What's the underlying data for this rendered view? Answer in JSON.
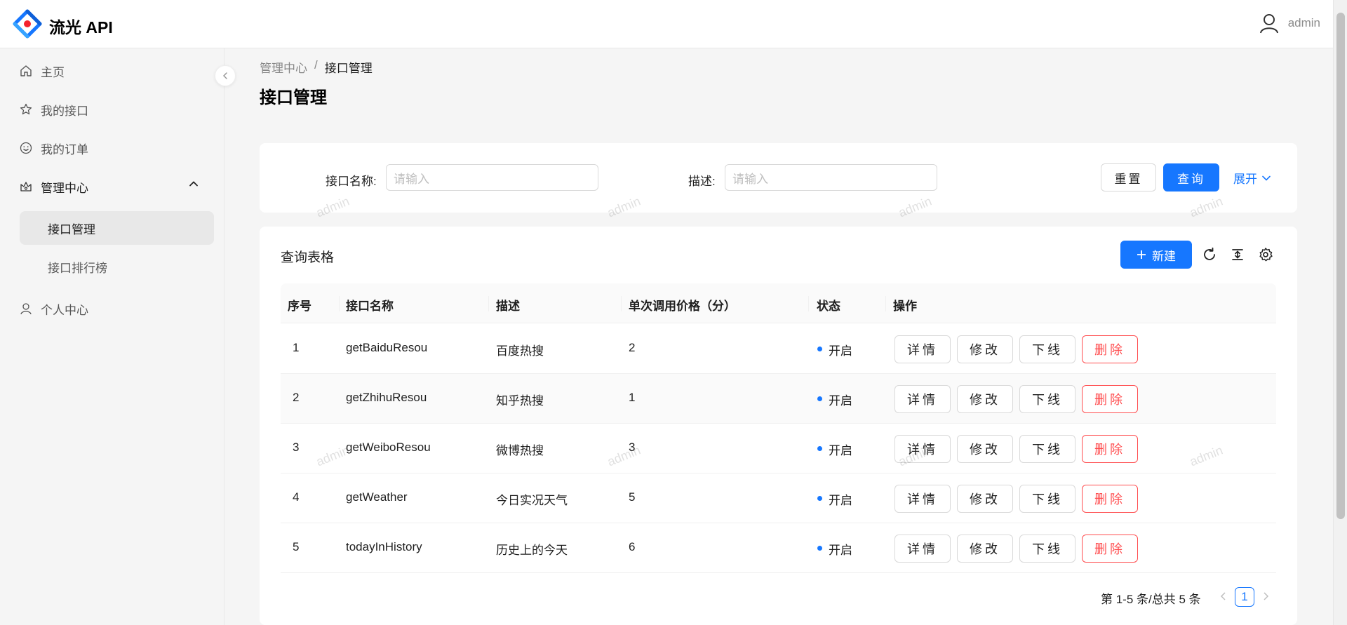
{
  "header": {
    "app_title": "流光 API",
    "username": "admin"
  },
  "sidebar": {
    "items": [
      {
        "label": "主页",
        "icon": "home-icon"
      },
      {
        "label": "我的接口",
        "icon": "star-icon"
      },
      {
        "label": "我的订单",
        "icon": "smile-icon"
      },
      {
        "label": "管理中心",
        "icon": "crown-icon",
        "children": [
          {
            "label": "接口管理"
          },
          {
            "label": "接口排行榜"
          }
        ]
      },
      {
        "label": "个人中心",
        "icon": "user-icon"
      }
    ]
  },
  "breadcrumb": {
    "parent": "管理中心",
    "separator": "/",
    "current": "接口管理"
  },
  "page_title": "接口管理",
  "search": {
    "name_label": "接口名称:",
    "name_placeholder": "请输入",
    "desc_label": "描述:",
    "desc_placeholder": "请输入",
    "reset_label": "重置",
    "query_label": "查询",
    "expand_label": "展开"
  },
  "table": {
    "title": "查询表格",
    "new_label": "新建",
    "columns": [
      "序号",
      "接口名称",
      "描述",
      "单次调用价格（分）",
      "状态",
      "操作"
    ],
    "rows": [
      {
        "index": "1",
        "name": "getBaiduResou",
        "desc": "百度热搜",
        "price": "2",
        "status": "开启"
      },
      {
        "index": "2",
        "name": "getZhihuResou",
        "desc": "知乎热搜",
        "price": "1",
        "status": "开启"
      },
      {
        "index": "3",
        "name": "getWeiboResou",
        "desc": "微博热搜",
        "price": "3",
        "status": "开启"
      },
      {
        "index": "4",
        "name": "getWeather",
        "desc": "今日实况天气",
        "price": "5",
        "status": "开启"
      },
      {
        "index": "5",
        "name": "todayInHistory",
        "desc": "历史上的今天",
        "price": "6",
        "status": "开启"
      }
    ],
    "actions": {
      "detail": "详情",
      "edit": "修改",
      "offline": "下线",
      "delete": "删除"
    }
  },
  "pagination": {
    "summary": "第 1-5 条/总共 5 条",
    "current_page": "1"
  },
  "watermark": "admin",
  "colors": {
    "primary": "#1677ff",
    "danger": "#ff4d4f",
    "status_dot": "#1677ff"
  }
}
